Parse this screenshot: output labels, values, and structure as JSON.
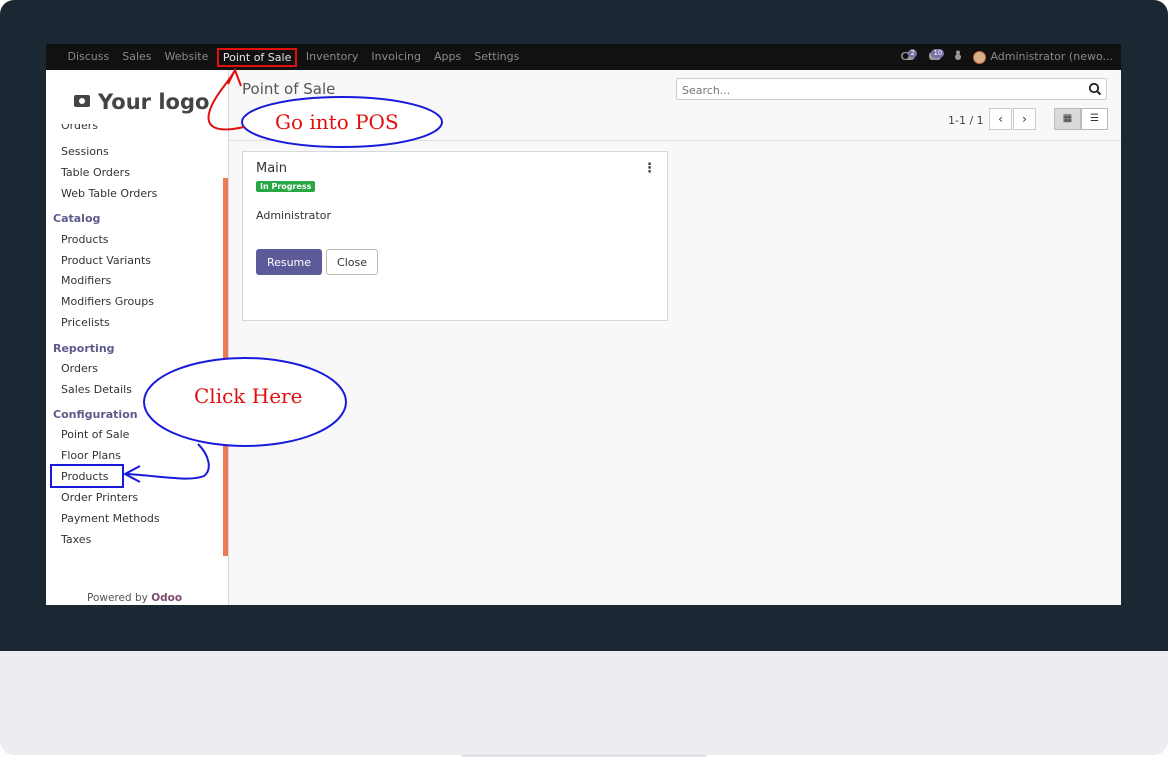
{
  "topbar": {
    "menu": [
      "Discuss",
      "Sales",
      "Website",
      "Point of Sale",
      "Inventory",
      "Invoicing",
      "Apps",
      "Settings"
    ],
    "activity_badge": "2",
    "message_badge": "10",
    "user": "Administrator (newo..."
  },
  "sidebar": {
    "logo": "Your logo",
    "cut_item": "Orders",
    "items_top": [
      "Sessions",
      "Table Orders",
      "Web Table Orders"
    ],
    "catalog": {
      "heading": "Catalog",
      "items": [
        "Products",
        "Product Variants",
        "Modifiers",
        "Modifiers Groups",
        "Pricelists"
      ]
    },
    "reporting": {
      "heading": "Reporting",
      "items": [
        "Orders",
        "Sales Details"
      ]
    },
    "configuration": {
      "heading": "Configuration",
      "items": [
        "Point of Sale",
        "Floor Plans",
        "Products",
        "Order Printers",
        "Payment Methods",
        "Taxes"
      ]
    },
    "powered_prefix": "Powered by",
    "powered_brand": "Odoo"
  },
  "main": {
    "title": "Point of Sale",
    "search_placeholder": "Search...",
    "pager": "1-1 / 1",
    "card": {
      "title": "Main",
      "status": "In Progress",
      "user": "Administrator",
      "resume_label": "Resume",
      "close_label": "Close"
    }
  },
  "annotations": {
    "go_into_pos": "Go into POS",
    "click_here": "Click Here",
    "red_color": "#e01010",
    "blue_color": "#1a1adb"
  },
  "colors": {
    "topbar": "#111111",
    "primary": "#5d5a9a",
    "status_green": "#28a745",
    "sidebar_heading": "#5d5a8c",
    "accent_bar": "#ed7b55"
  }
}
